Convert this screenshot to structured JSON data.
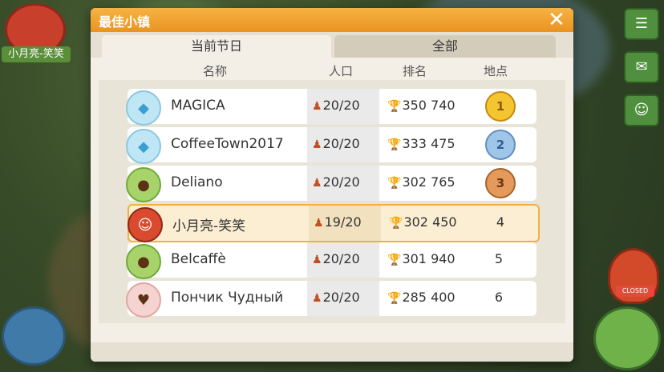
{
  "hud": {
    "player_name": "小月亮-笑笑",
    "closed_label": "CLOSED"
  },
  "dialog": {
    "title": "最佳小镇",
    "close_icon": "✕",
    "tabs": [
      {
        "label": "当前节日",
        "active": true
      },
      {
        "label": "全部",
        "active": false
      }
    ],
    "columns": {
      "name": "名称",
      "population": "人口",
      "ranking": "排名",
      "place": "地点"
    },
    "rows": [
      {
        "badge": "diamond",
        "name": "MAGICA",
        "population": "20/20",
        "score": "350 740",
        "place": "1",
        "medal": "gold"
      },
      {
        "badge": "diamond",
        "name": "CoffeeTown2017",
        "population": "20/20",
        "score": "333 475",
        "place": "2",
        "medal": "silver"
      },
      {
        "badge": "coffee",
        "name": "Deliano",
        "population": "20/20",
        "score": "302 765",
        "place": "3",
        "medal": "bronze"
      },
      {
        "badge": "cat",
        "name": "小月亮-笑笑",
        "population": "19/20",
        "score": "302 450",
        "place": "4",
        "highlight": true
      },
      {
        "badge": "coffee",
        "name": "Belcaffè",
        "population": "20/20",
        "score": "301 940",
        "place": "5"
      },
      {
        "badge": "heart",
        "name": "Пончик Чудный",
        "population": "20/20",
        "score": "285 400",
        "place": "6"
      }
    ]
  },
  "colors": {
    "title_bar": "#ea9321",
    "highlight_border": "#f0b13e"
  }
}
